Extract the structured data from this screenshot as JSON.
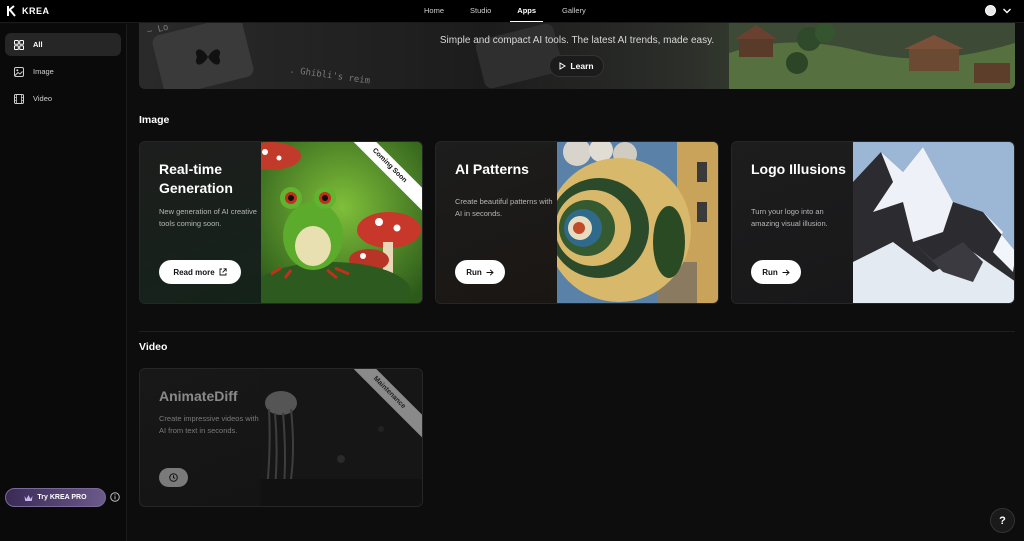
{
  "app": {
    "logo_text": "KREA"
  },
  "nav": {
    "items": [
      {
        "label": "Home"
      },
      {
        "label": "Studio"
      },
      {
        "label": "Apps"
      },
      {
        "label": "Gallery"
      }
    ],
    "active": "Apps"
  },
  "sidebar": {
    "items": [
      {
        "label": "All",
        "icon": "grid-icon"
      },
      {
        "label": "Image",
        "icon": "image-icon"
      },
      {
        "label": "Video",
        "icon": "film-icon"
      }
    ],
    "pro_button": "Try KREA PRO"
  },
  "hero": {
    "subtitle": "Simple and compact AI tools. The latest AI trends, made easy.",
    "learn_label": "Learn"
  },
  "sections": {
    "image_title": "Image",
    "video_title": "Video"
  },
  "cards": {
    "realtime": {
      "title": "Real-time Generation",
      "desc": "New generation of AI creative tools coming soon.",
      "button": "Read more",
      "ribbon": "Coming Soon"
    },
    "patterns": {
      "title": "AI Patterns",
      "desc": "Create beautiful patterns with AI in seconds.",
      "button": "Run"
    },
    "logo": {
      "title": "Logo Illusions",
      "desc": "Turn your logo into an amazing visual illusion.",
      "button": "Run"
    },
    "animatediff": {
      "title": "AnimateDiff",
      "desc": "Create impressive videos with AI from text in seconds.",
      "ribbon": "Maintenance"
    }
  },
  "help": {
    "label": "?"
  },
  "colors": {
    "background": "#0d0d0d",
    "accent": "#ffffff",
    "pro_gradient": "#6b5a8a"
  }
}
